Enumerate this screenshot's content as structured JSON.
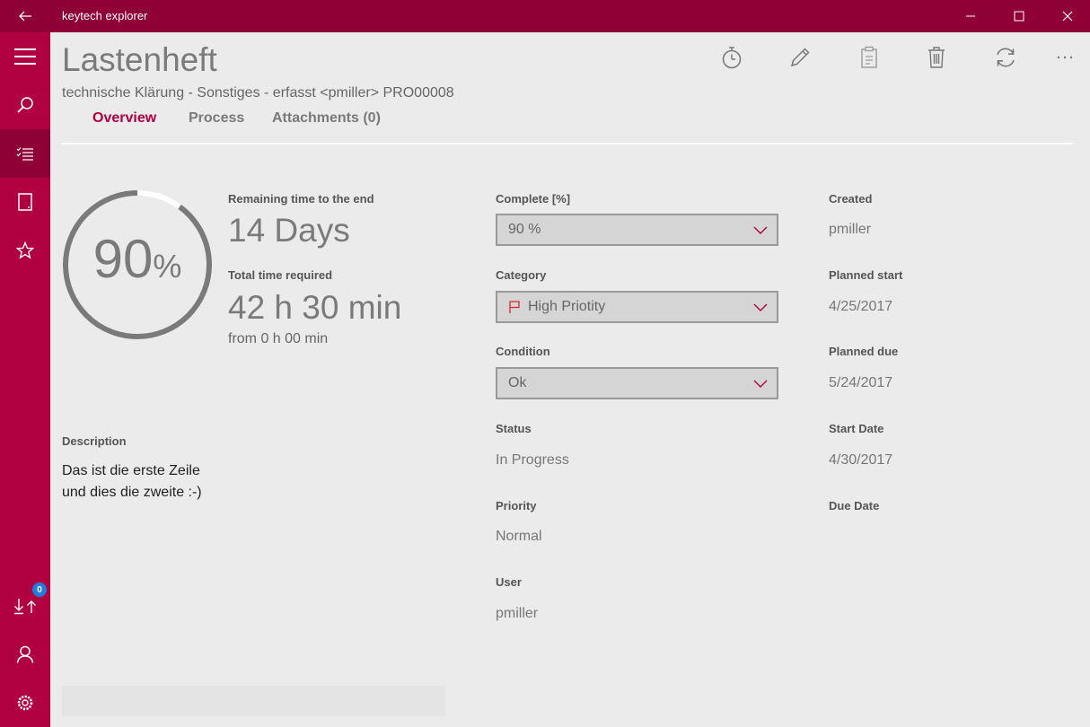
{
  "window": {
    "title": "keytech explorer",
    "back_icon": "arrow-left-icon",
    "controls": [
      "minimize-icon",
      "maximize-icon",
      "close-icon"
    ],
    "accent": "#b1003f",
    "accent_dark": "#8f0036"
  },
  "sidebar": {
    "items": [
      {
        "icon": "hamburger-menu-icon"
      },
      {
        "icon": "search-icon"
      },
      {
        "icon": "task-list-icon",
        "active": true
      },
      {
        "icon": "tablet-icon"
      },
      {
        "icon": "star-icon"
      },
      {
        "icon": "download-upload-icon",
        "badge": "0"
      },
      {
        "icon": "user-icon"
      },
      {
        "icon": "settings-gear-icon"
      }
    ]
  },
  "header": {
    "title": "Lastenheft",
    "subtitle": "technische Klärung - Sonstiges - erfasst <pmiller> PRO00008",
    "tabs": [
      {
        "label": "Overview",
        "active": true
      },
      {
        "label": "Process"
      },
      {
        "label": "Attachments (0)"
      }
    ],
    "toolbar": [
      "stopwatch-icon",
      "pencil-icon",
      "clipboard-icon",
      "trash-icon",
      "refresh-icon",
      "more-icon"
    ]
  },
  "progress": {
    "percent_num": "90",
    "percent_sign": "%",
    "fraction": 0.9,
    "remaining_label": "Remaining time to the end",
    "remaining_value": "14 Days",
    "total_label": "Total time required",
    "total_value": "42 h 30 min",
    "total_from": "from 0 h 00 min"
  },
  "description": {
    "label": "Description",
    "line1": "Das ist die erste Zeile",
    "line2": "und dies die zweite :-)"
  },
  "middle": {
    "complete_label": "Complete [%]",
    "complete_value": "90 %",
    "category_label": "Category",
    "category_value": "High Priotity",
    "category_icon": "red-flag-icon",
    "condition_label": "Condition",
    "condition_value": "Ok",
    "status_label": "Status",
    "status_value": "In Progress",
    "priority_label": "Priority",
    "priority_value": "Normal",
    "user_label": "User",
    "user_value": "pmiller"
  },
  "right": {
    "created_label": "Created",
    "created_value": "pmiller",
    "planned_start_label": "Planned start",
    "planned_start_value": "4/25/2017",
    "planned_due_label": "Planned due",
    "planned_due_value": "5/24/2017",
    "start_date_label": "Start Date",
    "start_date_value": "4/30/2017",
    "due_date_label": "Due Date"
  }
}
